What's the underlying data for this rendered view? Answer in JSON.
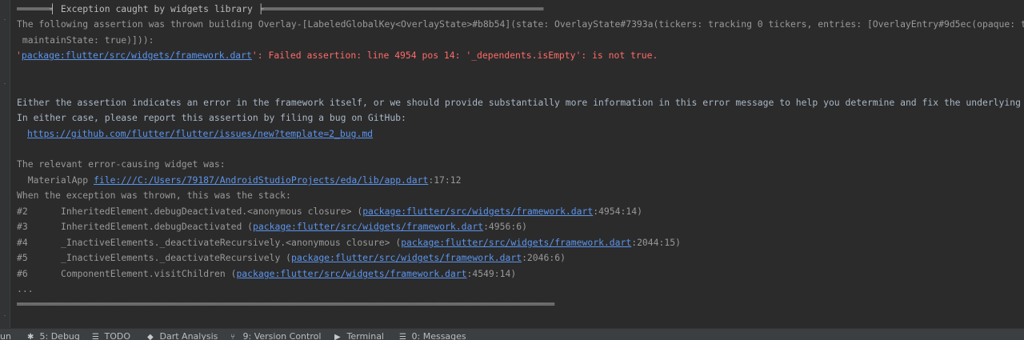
{
  "console": {
    "header_rule": "══════╡ Exception caught by widgets library ╞═══════════════════════════════════════════════════",
    "thrown_line1": "The following assertion was thrown building Overlay-[LabeledGlobalKey<OverlayState>#b8b54](state: OverlayState#7393a(tickers: tracking 0 tickers, entries: [OverlayEntry#9d5ec(opaque: t",
    "thrown_line2": " maintainState: true)])):",
    "assert_quote_open": "'",
    "assert_link": "package:flutter/src/widgets/framework.dart",
    "assert_message": "': Failed assertion: line 4954 pos 14: '_dependents.isEmpty': is not true.",
    "either_line": "Either the assertion indicates an error in the framework itself, or we should provide substantially more information in this error message to help you determine and fix the underlying",
    "report_line": "In either case, please report this assertion by filing a bug on GitHub:",
    "github_link": "https://github.com/flutter/flutter/issues/new?template=2_bug.md",
    "relevant_line": "The relevant error-causing widget was:",
    "widget_name": "  MaterialApp ",
    "widget_link": "file:///C:/Users/79187/AndroidStudioProjects/eda/lib/app.dart",
    "widget_loc": ":17:12",
    "when_line": "When the exception was thrown, this was the stack:",
    "stack": [
      {
        "num": "#2",
        "text": "InheritedElement.debugDeactivated.<anonymous closure> (",
        "link": "package:flutter/src/widgets/framework.dart",
        "loc": ":4954:14)"
      },
      {
        "num": "#3",
        "text": "InheritedElement.debugDeactivated (",
        "link": "package:flutter/src/widgets/framework.dart",
        "loc": ":4956:6)"
      },
      {
        "num": "#4",
        "text": "_InactiveElements._deactivateRecursively.<anonymous closure> (",
        "link": "package:flutter/src/widgets/framework.dart",
        "loc": ":2044:15)"
      },
      {
        "num": "#5",
        "text": "_InactiveElements._deactivateRecursively (",
        "link": "package:flutter/src/widgets/framework.dart",
        "loc": ":2046:6)"
      },
      {
        "num": "#6",
        "text": "ComponentElement.visitChildren (",
        "link": "package:flutter/src/widgets/framework.dart",
        "loc": ":4549:14)"
      }
    ],
    "ellipsis": "...",
    "footer_rule": "══════════════════════════════════════════════════════════════════════════════════════════════════"
  },
  "statusbar": {
    "run_label": "un",
    "tabs": [
      {
        "icon": "bug-icon",
        "glyph": "✱",
        "label": "5: Debug"
      },
      {
        "icon": "todo-list-icon",
        "glyph": "☰",
        "label": "TODO"
      },
      {
        "icon": "dart-analysis-icon",
        "glyph": "◆",
        "label": "Dart Analysis"
      },
      {
        "icon": "version-control-icon",
        "glyph": "⑂",
        "label": "9: Version Control"
      },
      {
        "icon": "terminal-icon",
        "glyph": "▶",
        "label": "Terminal"
      },
      {
        "icon": "messages-icon",
        "glyph": "☰",
        "label": "0: Messages"
      }
    ]
  }
}
